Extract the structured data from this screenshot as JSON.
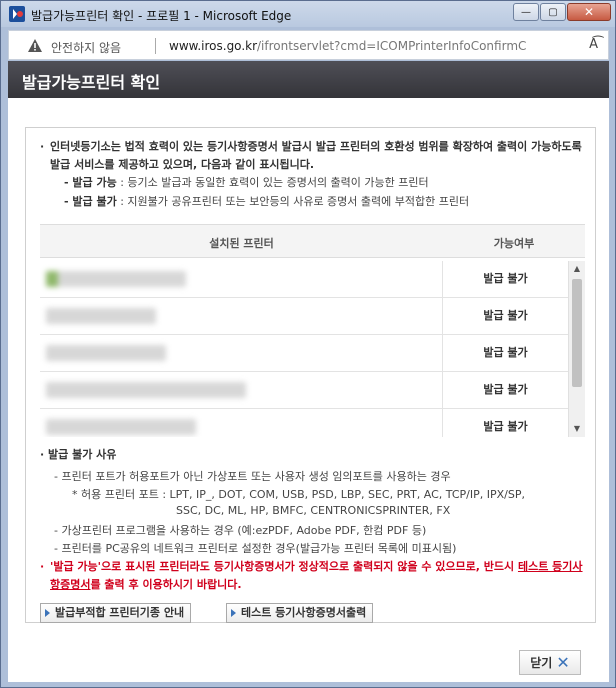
{
  "window": {
    "title": "발급가능프린터 확인 - 프로필 1 - Microsoft Edge",
    "minimize": "—",
    "maximize": "▢",
    "close": "✕"
  },
  "address": {
    "security": "안전하지 않음",
    "domain": "www.iros.go.kr",
    "path": "/ifrontservlet?cmd=ICOMPrinterInfoConfirmC",
    "read_icon": "A͡"
  },
  "header": {
    "title": "발급가능프린터 확인"
  },
  "intro": {
    "bullet": "·",
    "text": "인터넷등기소는 법적 효력이 있는 등기사항증명서 발급시 발급 프린터의 호환성 범위를 확장하여 출력이 가능하도록 발급 서비스를 제공하고 있으며, 다음과 같이 표시됩니다.",
    "items": [
      {
        "label": "- 발급 가능",
        "desc": " : 등기소 발급과 동일한 효력이 있는 증명서의 출력이 가능한 프린터"
      },
      {
        "label": "- 발급 불가",
        "desc": " : 지원불가 공유프린터 또는 보안등의 사유로 증명서 출력에 부적합한 프린터"
      }
    ]
  },
  "table": {
    "headers": [
      "설치된 프린터",
      "가능여부"
    ],
    "rows": [
      {
        "status": "발급 불가"
      },
      {
        "status": "발급 불가"
      },
      {
        "status": "발급 불가"
      },
      {
        "status": "발급 불가"
      },
      {
        "status": "발급 불가"
      }
    ],
    "scroll_up": "▲",
    "scroll_down": "▼"
  },
  "reasons": {
    "title": "· 발급 불가 사유",
    "lines": [
      "- 프린터 포트가 허용포트가 아닌 가상포트 또는 사용자 생성 임의포트를 사용하는 경우",
      "* 허용 프린터 포트 : LPT, IP_, DOT, COM, USB, PSD, LBP, SEC, PRT, AC, TCP/IP, IPX/SP,",
      "SSC, DC, ML, HP, BMFC, CENTRONICSPRINTER, FX",
      "- 가상프린터 프로그램을 사용하는 경우 (예:ezPDF, Adobe PDF, 한컴 PDF 등)",
      "- 프린터를 PC공유의 네트워크 프린터로 설정한 경우(발급가능 프린터 목록에 미표시됨)"
    ]
  },
  "warning": {
    "bullet": "·",
    "part1": "'발급 가능'으로 표시된 프린터라도 등기사항증명서가 정상적으로 출력되지 않을 수 있으므로, 반드시 ",
    "link": "테스트 등기사항증명서",
    "part2": "를 출력 후 이용하시기 바랍니다."
  },
  "buttons": {
    "guide": "발급부적합 프린터기종 안내",
    "test_print": "테스트 등기사항증명서출력",
    "close": "닫기"
  },
  "colors": {
    "header_bg": "#3f3f45",
    "warning": "#d0001c",
    "accent": "#3b73b9"
  }
}
